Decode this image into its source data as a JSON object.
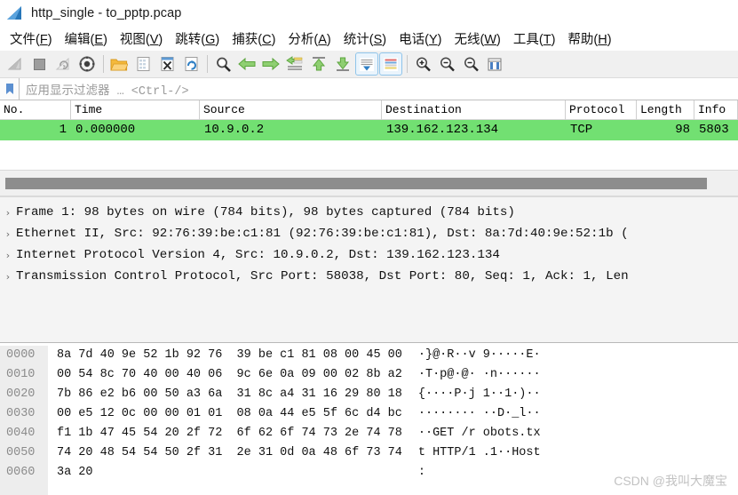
{
  "window": {
    "title": "http_single - to_pptp.pcap",
    "logo_icon": "wireshark-shark-fin-icon"
  },
  "menu": {
    "items": [
      {
        "label": "文件",
        "mnemonic": "F"
      },
      {
        "label": "编辑",
        "mnemonic": "E"
      },
      {
        "label": "视图",
        "mnemonic": "V"
      },
      {
        "label": "跳转",
        "mnemonic": "G"
      },
      {
        "label": "捕获",
        "mnemonic": "C"
      },
      {
        "label": "分析",
        "mnemonic": "A"
      },
      {
        "label": "统计",
        "mnemonic": "S"
      },
      {
        "label": "电话",
        "mnemonic": "Y"
      },
      {
        "label": "无线",
        "mnemonic": "W"
      },
      {
        "label": "工具",
        "mnemonic": "T"
      },
      {
        "label": "帮助",
        "mnemonic": "H"
      }
    ]
  },
  "toolbar": {
    "groups": [
      [
        "start-capture-icon",
        "stop-capture-icon",
        "restart-capture-icon",
        "capture-options-icon"
      ],
      [
        "open-file-icon",
        "save-file-icon",
        "close-file-icon",
        "reload-file-icon"
      ],
      [
        "find-packet-icon",
        "go-back-icon",
        "go-forward-icon",
        "go-to-packet-icon",
        "go-to-first-packet-icon",
        "go-to-last-packet-icon",
        "auto-scroll-icon",
        "colorize-packets-icon"
      ],
      [
        "zoom-in-icon",
        "zoom-out-icon",
        "zoom-reset-icon",
        "resize-columns-icon"
      ]
    ]
  },
  "filter": {
    "icon": "filter-bookmark-icon",
    "placeholder": "应用显示过滤器 … <Ctrl-/>",
    "value": ""
  },
  "packet_list": {
    "columns": [
      "No.",
      "Time",
      "Source",
      "Destination",
      "Protocol",
      "Length",
      "Info"
    ],
    "rows": [
      {
        "no": "1",
        "time": "0.000000",
        "source": "10.9.0.2",
        "destination": "139.162.123.134",
        "protocol": "TCP",
        "length": "98",
        "info": "5803",
        "selected": true,
        "row_color": "#72e072"
      }
    ]
  },
  "detail_pane": {
    "arrow_glyph": "›",
    "rows": [
      "Frame 1: 98 bytes on wire (784 bits), 98 bytes captured (784 bits)",
      "Ethernet II, Src: 92:76:39:be:c1:81 (92:76:39:be:c1:81), Dst: 8a:7d:40:9e:52:1b (",
      "Internet Protocol Version 4, Src: 10.9.0.2, Dst: 139.162.123.134",
      "Transmission Control Protocol, Src Port: 58038, Dst Port: 80, Seq: 1, Ack: 1, Len"
    ]
  },
  "hex_pane": {
    "lines": [
      {
        "offset": "0000",
        "bytes": "8a 7d 40 9e 52 1b 92 76  39 be c1 81 08 00 45 00",
        "ascii": "·}@·R··v 9·····E·"
      },
      {
        "offset": "0010",
        "bytes": "00 54 8c 70 40 00 40 06  9c 6e 0a 09 00 02 8b a2",
        "ascii": "·T·p@·@· ·n······"
      },
      {
        "offset": "0020",
        "bytes": "7b 86 e2 b6 00 50 a3 6a  31 8c a4 31 16 29 80 18",
        "ascii": "{····P·j 1··1·)··"
      },
      {
        "offset": "0030",
        "bytes": "00 e5 12 0c 00 00 01 01  08 0a 44 e5 5f 6c d4 bc",
        "ascii": "········ ··D·_l··"
      },
      {
        "offset": "0040",
        "bytes": "f1 1b 47 45 54 20 2f 72  6f 62 6f 74 73 2e 74 78",
        "ascii": "··GET /r obots.tx"
      },
      {
        "offset": "0050",
        "bytes": "74 20 48 54 54 50 2f 31  2e 31 0d 0a 48 6f 73 74",
        "ascii": "t HTTP/1 .1··Host"
      },
      {
        "offset": "0060",
        "bytes": "3a 20",
        "ascii": ": "
      }
    ]
  },
  "watermark": {
    "text": "CSDN @我叫大魔宝"
  }
}
